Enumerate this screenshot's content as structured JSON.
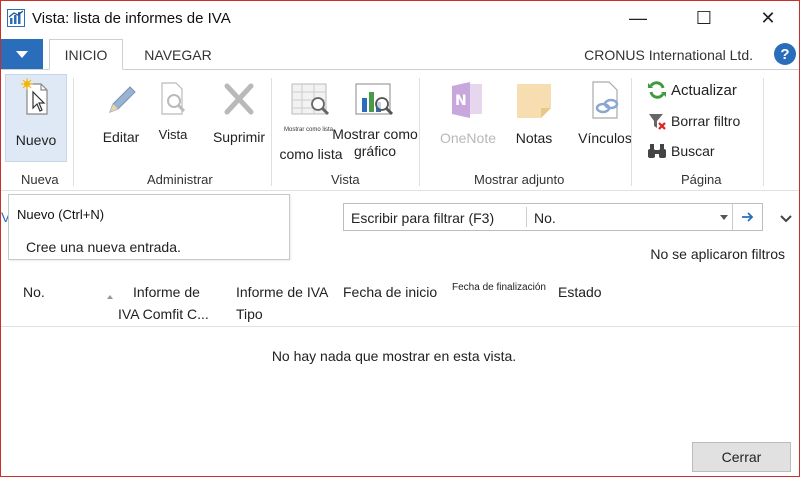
{
  "window": {
    "title": "Vista: lista de informes de IVA",
    "minimize_glyph": "—",
    "maximize_glyph": "☐",
    "close_glyph": "✕"
  },
  "tabs": [
    {
      "label": "INICIO",
      "active": true
    },
    {
      "label": "NAVEGAR",
      "active": false
    }
  ],
  "company": "CRONUS International Ltd.",
  "help_glyph": "?",
  "ribbon": {
    "groups": {
      "nueva": "Nueva",
      "administrar": "Administrar",
      "vista": "Vista",
      "mostrar_adjunto": "Mostrar adjunto",
      "pagina": "Página"
    },
    "buttons": {
      "nuevo": "Nuevo",
      "editar": "Editar",
      "vista": "Vista",
      "suprimir": "Suprimir",
      "mostrar_lista_tiny": "Mostrar como lista",
      "como_lista": "como lista",
      "mostrar_grafico_1": "Mostrar como",
      "mostrar_grafico_2": "gráfico",
      "onenote": "OneNote",
      "notas": "Notas",
      "vinculos": "Vínculos",
      "actualizar": "Actualizar",
      "borrar_filtro": "Borrar filtro",
      "buscar": "Buscar"
    }
  },
  "tooltip": {
    "title": "Nuevo (Ctrl+N)",
    "description": "Cree una nueva entrada."
  },
  "left_truncated": "V",
  "filter": {
    "label": "Escribir para filtrar (F3)",
    "field": "No.",
    "status": "No se aplicaron filtros"
  },
  "columns": {
    "no": "No.",
    "informe_comfit_1": "Informe de",
    "informe_comfit_2": "IVA Comfit C...",
    "informe_tipo_1": "Informe de IVA",
    "informe_tipo_2": "Tipo",
    "fecha_inicio": "Fecha de inicio",
    "fecha_fin": "Fecha de finalización",
    "estado": "Estado"
  },
  "empty_message": "No hay nada que mostrar en esta vista.",
  "close_button": "Cerrar",
  "colors": {
    "accent": "#2a6ebb",
    "window_border": "#c9302c",
    "nuevo_highlight": "#dfe9f5"
  }
}
